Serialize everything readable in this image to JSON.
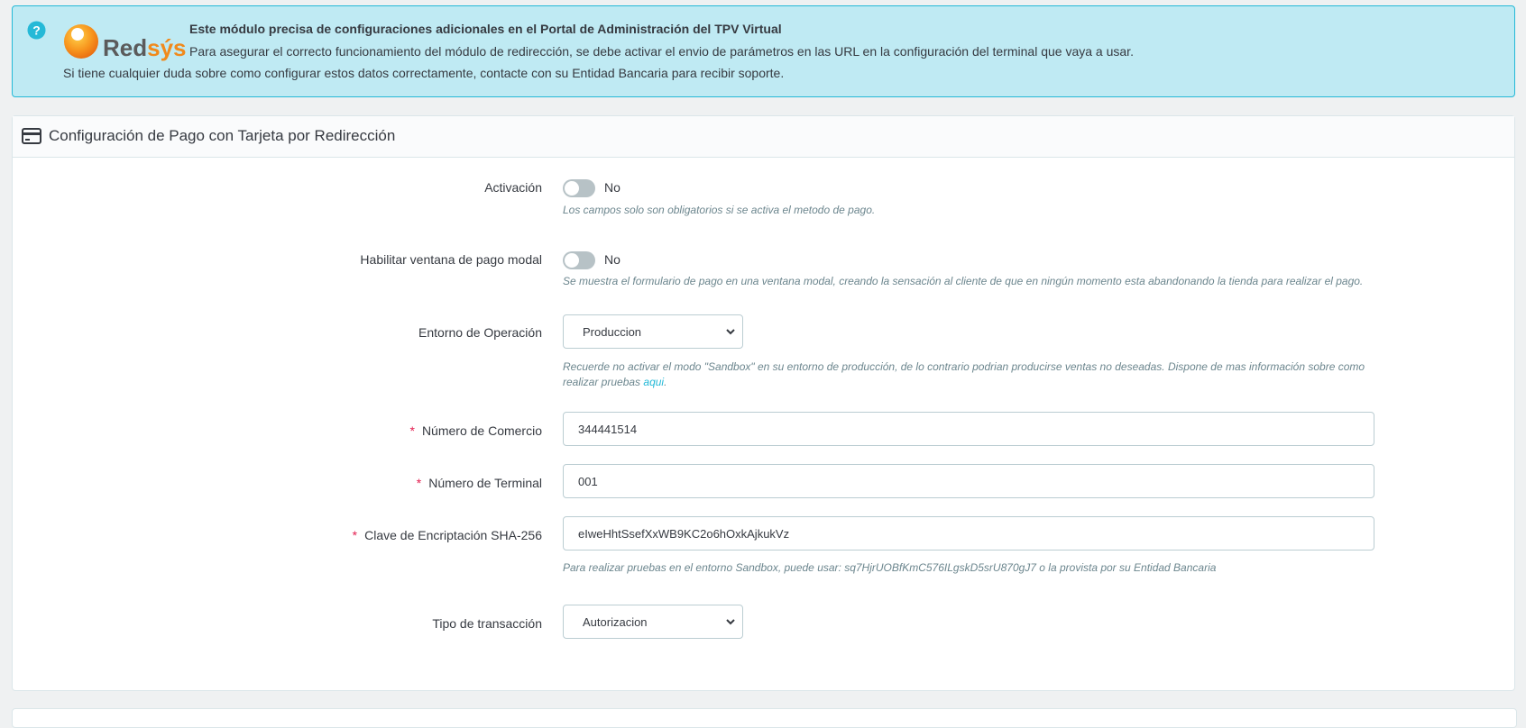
{
  "alert": {
    "logo_text": "Redsýs",
    "title": "Este módulo precisa de configuraciones adicionales en el Portal de Administración del TPV Virtual",
    "line2": "Para asegurar el correcto funcionamiento del módulo de redirección, se debe activar el envio de parámetros en las URL en la configuración del terminal que vaya a usar.",
    "line3": "Si tiene cualquier duda sobre como configurar estos datos correctamente, contacte con su Entidad Bancaria para recibir soporte."
  },
  "panel": {
    "title": "Configuración de Pago con Tarjeta por Redirección",
    "activacion": {
      "label": "Activación",
      "value": "No",
      "help": "Los campos solo son obligatorios si se activa el metodo de pago."
    },
    "modal": {
      "label": "Habilitar ventana de pago modal",
      "value": "No",
      "help": "Se muestra el formulario de pago en una ventana modal, creando la sensación al cliente de que en ningún momento esta abandonando la tienda para realizar el pago."
    },
    "entorno": {
      "label": "Entorno de Operación",
      "selected": "Produccion",
      "help_line1": "Recuerde no activar el modo \"Sandbox\" en su entorno de producción, de lo contrario podrian producirse ventas no deseadas. Dispone de mas información sobre como",
      "help_line2": "realizar pruebas",
      "help_link": "aqui",
      "help_end": "."
    },
    "comercio": {
      "required_mark": "*",
      "label": "Número de Comercio",
      "value": "344441514"
    },
    "terminal": {
      "required_mark": "*",
      "label": "Número de Terminal",
      "value": "001"
    },
    "clave": {
      "required_mark": "*",
      "label": "Clave de Encriptación SHA-256",
      "value": "eIweHhtSsefXxWB9KC2o6hOxkAjkukVz",
      "help": "Para realizar pruebas en el entorno Sandbox, puede usar: sq7HjrUOBfKmC576ILgskD5srU870gJ7 o la provista por su Entidad Bancaria"
    },
    "tipo": {
      "label": "Tipo de transacción",
      "selected": "Autorizacion"
    }
  },
  "colors": {
    "alert_bg": "#bfeaf3",
    "alert_border": "#25b9d7",
    "required": "#e31d4f",
    "link": "#25b9d7"
  }
}
